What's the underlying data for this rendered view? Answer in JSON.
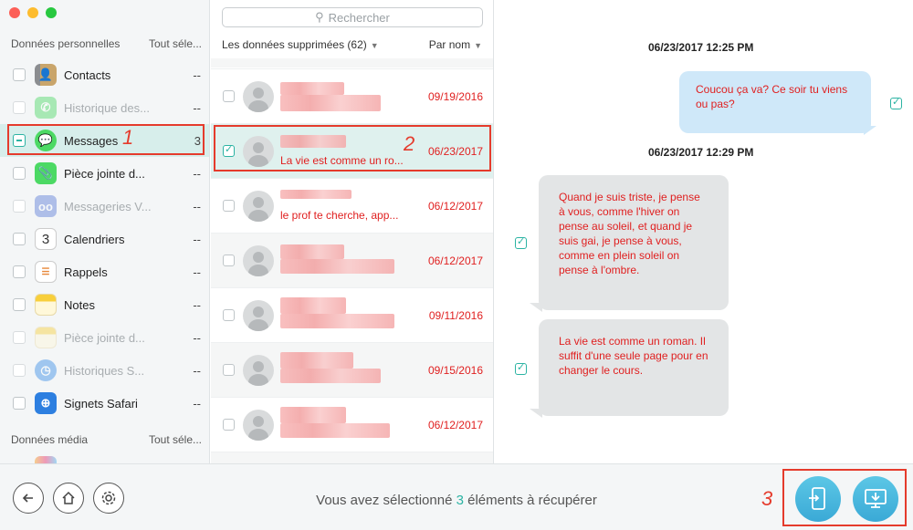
{
  "sidebar": {
    "personal_header": "Données personnelles",
    "select_all": "Tout séle...",
    "media_header": "Données média",
    "media_select_all": "Tout séle...",
    "items": [
      {
        "label": "Contacts",
        "count": "--",
        "icon": "contacts-icon"
      },
      {
        "label": "Historique des...",
        "count": "--",
        "icon": "phone-icon"
      },
      {
        "label": "Messages",
        "count": "3",
        "icon": "messages-icon"
      },
      {
        "label": "Pièce jointe d...",
        "count": "--",
        "icon": "attachment-icon"
      },
      {
        "label": "Messageries V...",
        "count": "--",
        "icon": "voicemail-icon"
      },
      {
        "label": "Calendriers",
        "count": "--",
        "icon": "calendar-icon"
      },
      {
        "label": "Rappels",
        "count": "--",
        "icon": "reminders-icon"
      },
      {
        "label": "Notes",
        "count": "--",
        "icon": "notes-icon"
      },
      {
        "label": "Pièce jointe d...",
        "count": "--",
        "icon": "notes-attachment-icon"
      },
      {
        "label": "Historiques S...",
        "count": "--",
        "icon": "safari-history-icon"
      },
      {
        "label": "Signets Safari",
        "count": "--",
        "icon": "safari-bookmarks-icon"
      }
    ]
  },
  "middle": {
    "search_placeholder": "Rechercher",
    "filter_label": "Les données supprimées (62)",
    "sort_label": "Par nom",
    "rows": [
      {
        "snippet": "",
        "date": "09/19/2016"
      },
      {
        "snippet": "La vie est comme un ro...",
        "date": "06/23/2017"
      },
      {
        "snippet": "le prof te cherche, app...",
        "date": "06/12/2017"
      },
      {
        "snippet": "",
        "date": "06/12/2017"
      },
      {
        "snippet": "",
        "date": "09/11/2016"
      },
      {
        "snippet": "",
        "date": "09/15/2016"
      },
      {
        "snippet": "",
        "date": "06/12/2017"
      }
    ]
  },
  "conversation": {
    "ts1": "06/23/2017 12:25 PM",
    "msg1": "Coucou ça va? Ce soir tu viens ou pas?",
    "ts2": "06/23/2017 12:29 PM",
    "msg2": "Quand je suis triste, je pense à vous, comme l'hiver on pense au soleil, et quand je suis gai, je pense à vous, comme en plein soleil on pense à l'ombre.",
    "msg3": "La vie est comme un roman. Il suffit d'une seule page pour en changer le cours."
  },
  "bottom": {
    "status_prefix": "Vous avez sélectionné ",
    "status_count": "3",
    "status_suffix": " éléments à récupérer"
  },
  "annotations": {
    "a1": "1",
    "a2": "2",
    "a3": "3"
  },
  "colors": {
    "accent": "#2bb3a3",
    "highlight": "#e53b2c",
    "message_text": "#e02020"
  }
}
